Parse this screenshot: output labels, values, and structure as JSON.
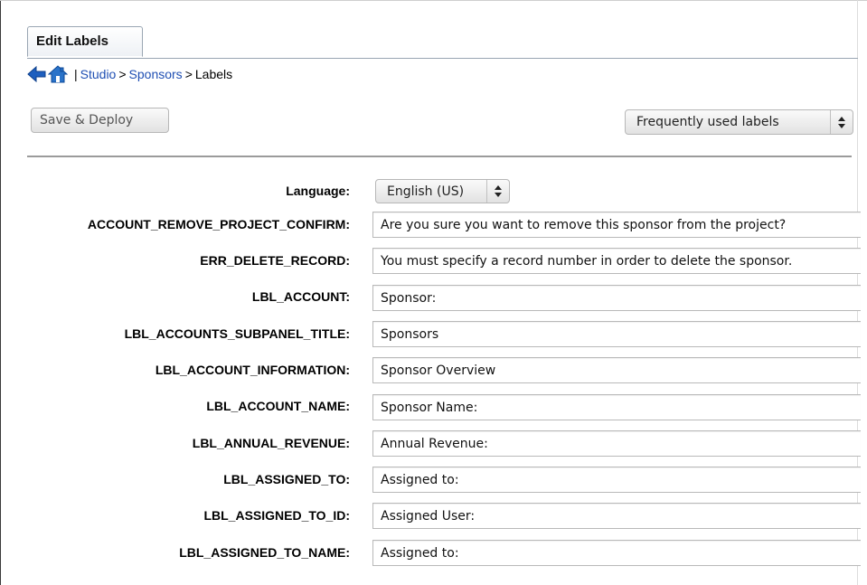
{
  "tab": {
    "label": "Edit Labels"
  },
  "breadcrumb": {
    "separator": "|",
    "studio": "Studio",
    "arrow1": ">",
    "module": "Sponsors",
    "arrow2": ">",
    "current": "Labels"
  },
  "toolbar": {
    "save_deploy": "Save & Deploy",
    "filter_value": "Frequently used labels"
  },
  "language": {
    "label": "Language:",
    "value": "English (US)"
  },
  "colors": {
    "link": "#1f4fb3",
    "divider": "#9b9b9b",
    "home_icon": "#2a73c9",
    "back_icon": "#1d5fbf"
  },
  "labels": [
    {
      "key": "ACCOUNT_REMOVE_PROJECT_CONFIRM:",
      "value": "Are you sure you want to remove this sponsor from the project?"
    },
    {
      "key": "ERR_DELETE_RECORD:",
      "value": "You must specify a record number in order to delete the sponsor."
    },
    {
      "key": "LBL_ACCOUNT:",
      "value": "Sponsor:"
    },
    {
      "key": "LBL_ACCOUNTS_SUBPANEL_TITLE:",
      "value": "Sponsors"
    },
    {
      "key": "LBL_ACCOUNT_INFORMATION:",
      "value": "Sponsor Overview"
    },
    {
      "key": "LBL_ACCOUNT_NAME:",
      "value": "Sponsor Name:"
    },
    {
      "key": "LBL_ANNUAL_REVENUE:",
      "value": "Annual Revenue:"
    },
    {
      "key": "LBL_ASSIGNED_TO:",
      "value": "Assigned to:"
    },
    {
      "key": "LBL_ASSIGNED_TO_ID:",
      "value": "Assigned User:"
    },
    {
      "key": "LBL_ASSIGNED_TO_NAME:",
      "value": "Assigned to:"
    }
  ]
}
